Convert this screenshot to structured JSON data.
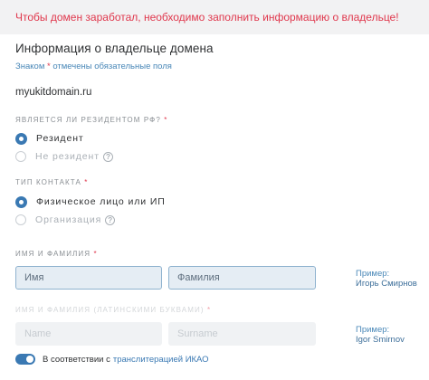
{
  "alert": "Чтобы домен заработал, необходимо заполнить информацию о владельце!",
  "form": {
    "title": "Информация о владельце домена",
    "required_note_prefix": "Знаком",
    "required_star": "*",
    "required_note_suffix": "отмечены обязательные поля",
    "domain": "myukitdomain.ru"
  },
  "resident": {
    "label": "Является ли резидентом РФ?",
    "star": "*",
    "options": [
      "Резидент",
      "Не резидент"
    ],
    "selected": "Резидент"
  },
  "contact_type": {
    "label": "Тип контакта",
    "star": "*",
    "options": [
      "Физическое лицо или ИП",
      "Организация"
    ],
    "selected": "Физическое лицо или ИП"
  },
  "name": {
    "label": "Имя и фамилия",
    "star": "*",
    "first_placeholder": "Имя",
    "last_placeholder": "Фамилия",
    "example_title": "Пример:",
    "example_value": "Игорь Смирнов"
  },
  "name_latin": {
    "label": "Имя и фамилия (латинскими буквами)",
    "star": "*",
    "first_placeholder": "Name",
    "last_placeholder": "Surname",
    "example_title": "Пример:",
    "example_value": "Igor Smirnov"
  },
  "translit": {
    "enabled": true,
    "text": "В соответствии с",
    "link": "транслитерацией ИКАО"
  },
  "colors": {
    "accent": "#3a79b3",
    "required": "#e0384d",
    "link": "#4a88b8"
  }
}
